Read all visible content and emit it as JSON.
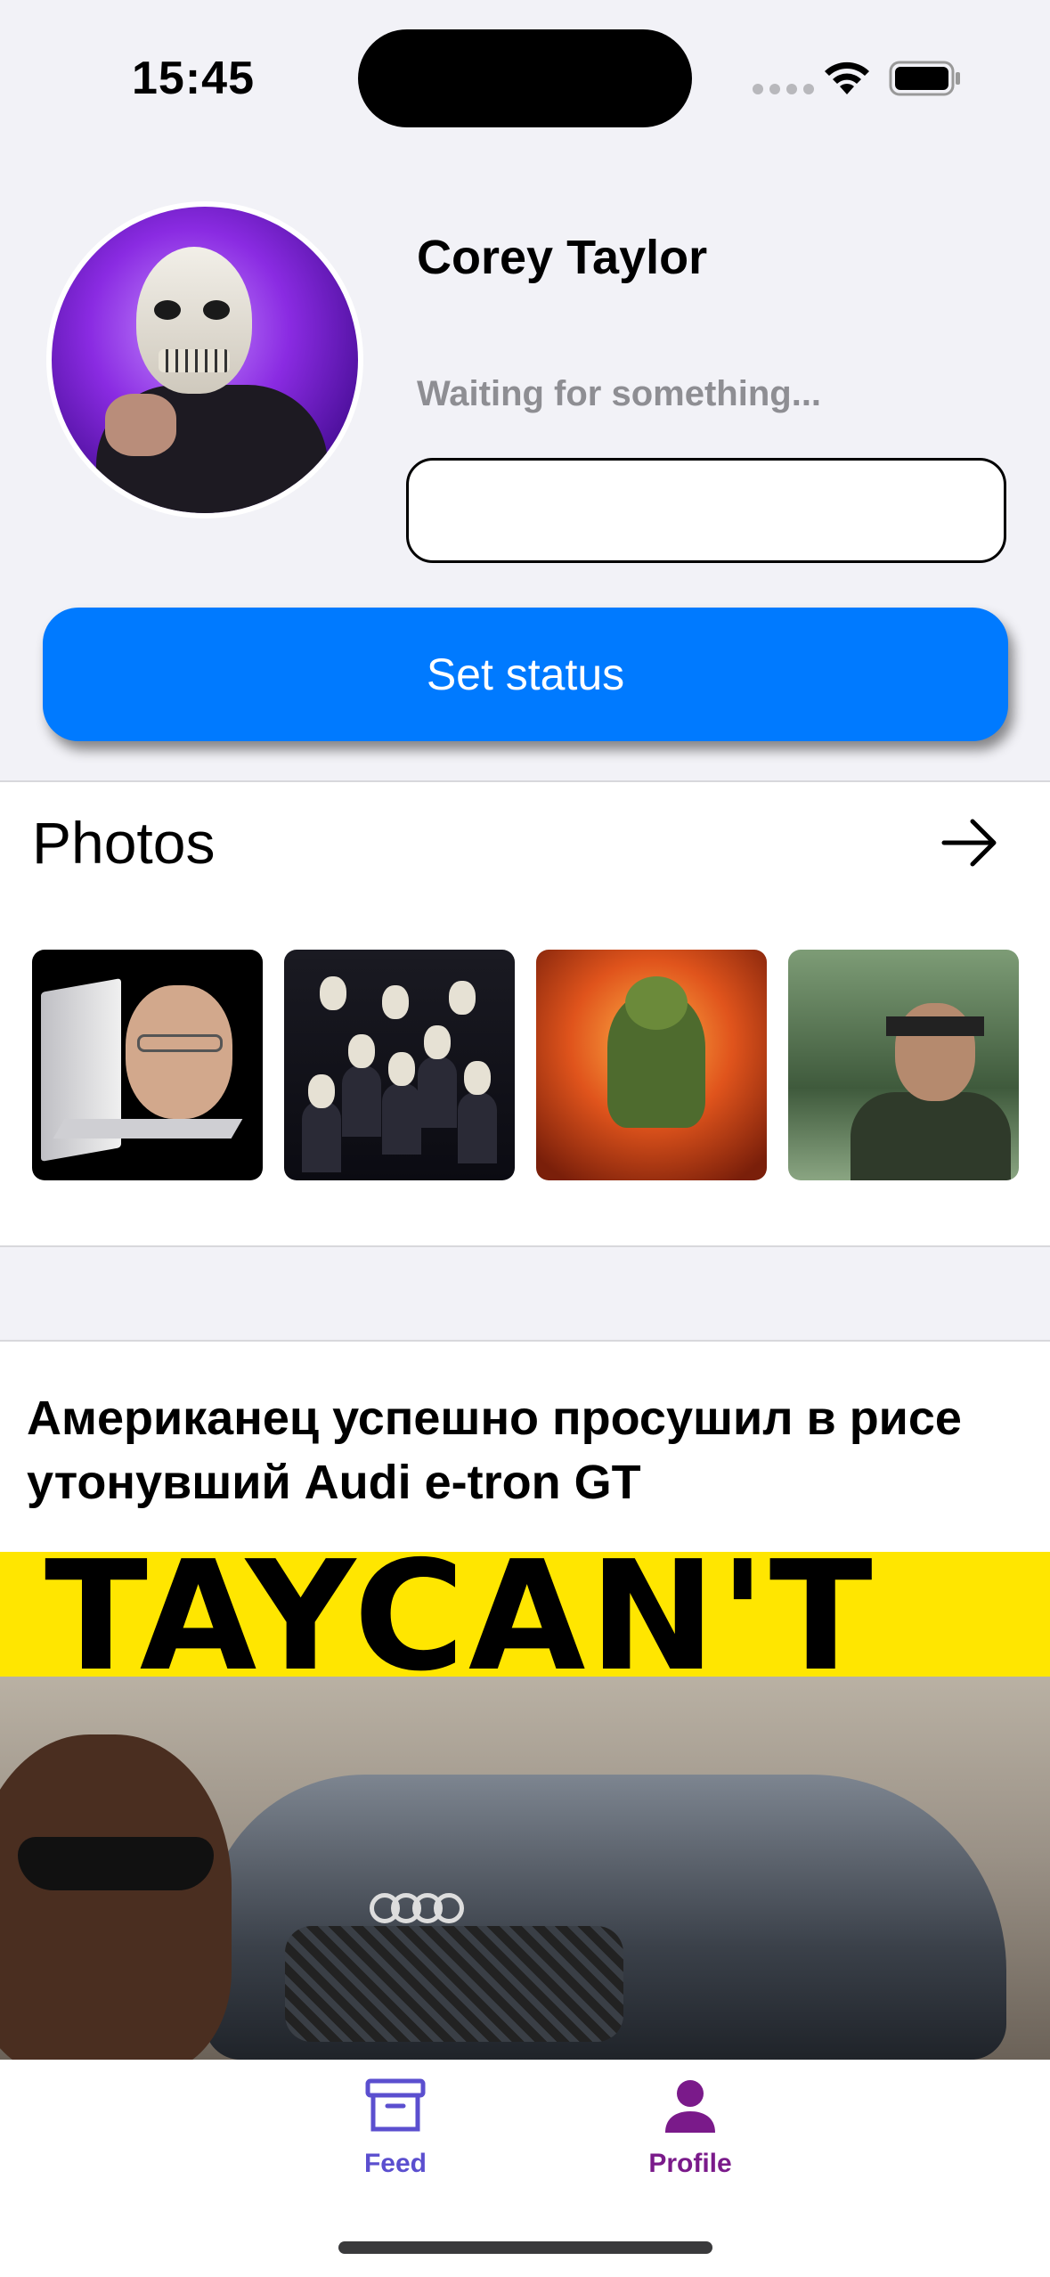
{
  "status_bar": {
    "time": "15:45"
  },
  "profile": {
    "name": "Corey Taylor",
    "status": "Waiting for something...",
    "status_input": {
      "value": "",
      "placeholder": ""
    },
    "set_status_label": "Set status"
  },
  "photos": {
    "title": "Photos",
    "items": [
      "photo-1",
      "photo-2",
      "photo-3",
      "photo-4"
    ]
  },
  "post": {
    "title": "Американец успешно просушил в рисе утонувший Audi e-tron GT",
    "image_banner_text": "TAYCAN'T"
  },
  "tabs": [
    {
      "label": "Feed",
      "icon": "archive-icon",
      "color": "#5b4fcf"
    },
    {
      "label": "Profile",
      "icon": "person-icon",
      "color": "#7a1a8a",
      "active": true
    }
  ],
  "colors": {
    "accent": "#007aff",
    "background": "#f2f2f7"
  }
}
